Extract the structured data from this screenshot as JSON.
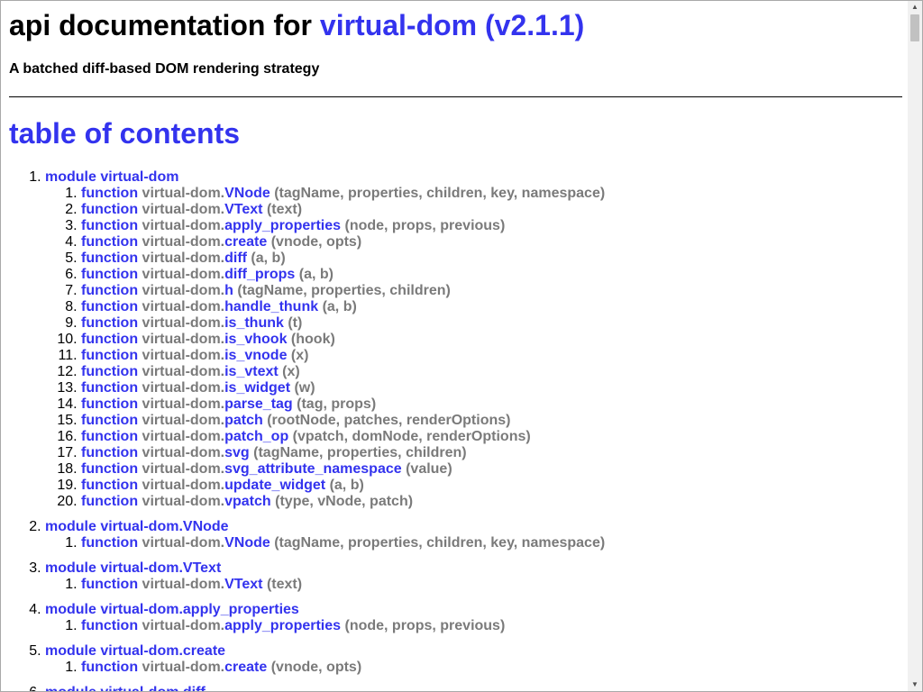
{
  "header": {
    "title_prefix": "api documentation for",
    "project": "virtual-dom (v2.1.1)",
    "subtitle": "A batched diff-based DOM rendering strategy"
  },
  "toc": {
    "heading": "table of contents",
    "keyword": "function",
    "modules": [
      {
        "label": "module virtual-dom",
        "functions": [
          {
            "ns": "virtual-dom.",
            "name": "VNode",
            "args": " (tagName, properties, children, key, namespace)"
          },
          {
            "ns": "virtual-dom.",
            "name": "VText",
            "args": " (text)"
          },
          {
            "ns": "virtual-dom.",
            "name": "apply_properties",
            "args": " (node, props, previous)"
          },
          {
            "ns": "virtual-dom.",
            "name": "create",
            "args": " (vnode, opts)"
          },
          {
            "ns": "virtual-dom.",
            "name": "diff",
            "args": " (a, b)"
          },
          {
            "ns": "virtual-dom.",
            "name": "diff_props",
            "args": " (a, b)"
          },
          {
            "ns": "virtual-dom.",
            "name": "h",
            "args": " (tagName, properties, children)"
          },
          {
            "ns": "virtual-dom.",
            "name": "handle_thunk",
            "args": " (a, b)"
          },
          {
            "ns": "virtual-dom.",
            "name": "is_thunk",
            "args": " (t)"
          },
          {
            "ns": "virtual-dom.",
            "name": "is_vhook",
            "args": " (hook)"
          },
          {
            "ns": "virtual-dom.",
            "name": "is_vnode",
            "args": " (x)"
          },
          {
            "ns": "virtual-dom.",
            "name": "is_vtext",
            "args": " (x)"
          },
          {
            "ns": "virtual-dom.",
            "name": "is_widget",
            "args": " (w)"
          },
          {
            "ns": "virtual-dom.",
            "name": "parse_tag",
            "args": " (tag, props)"
          },
          {
            "ns": "virtual-dom.",
            "name": "patch",
            "args": " (rootNode, patches, renderOptions)"
          },
          {
            "ns": "virtual-dom.",
            "name": "patch_op",
            "args": " (vpatch, domNode, renderOptions)"
          },
          {
            "ns": "virtual-dom.",
            "name": "svg",
            "args": " (tagName, properties, children)"
          },
          {
            "ns": "virtual-dom.",
            "name": "svg_attribute_namespace",
            "args": " (value)"
          },
          {
            "ns": "virtual-dom.",
            "name": "update_widget",
            "args": " (a, b)"
          },
          {
            "ns": "virtual-dom.",
            "name": "vpatch",
            "args": " (type, vNode, patch)"
          }
        ]
      },
      {
        "label": "module virtual-dom.VNode",
        "functions": [
          {
            "ns": "virtual-dom.",
            "name": "VNode",
            "args": " (tagName, properties, children, key, namespace)"
          }
        ]
      },
      {
        "label": "module virtual-dom.VText",
        "functions": [
          {
            "ns": "virtual-dom.",
            "name": "VText",
            "args": " (text)"
          }
        ]
      },
      {
        "label": "module virtual-dom.apply_properties",
        "functions": [
          {
            "ns": "virtual-dom.",
            "name": "apply_properties",
            "args": " (node, props, previous)"
          }
        ]
      },
      {
        "label": "module virtual-dom.create",
        "functions": [
          {
            "ns": "virtual-dom.",
            "name": "create",
            "args": " (vnode, opts)"
          }
        ]
      },
      {
        "label": "module virtual-dom.diff",
        "functions": []
      }
    ]
  },
  "colors": {
    "link": "#3333ee",
    "muted": "#7a7a7a",
    "text": "#000000"
  }
}
